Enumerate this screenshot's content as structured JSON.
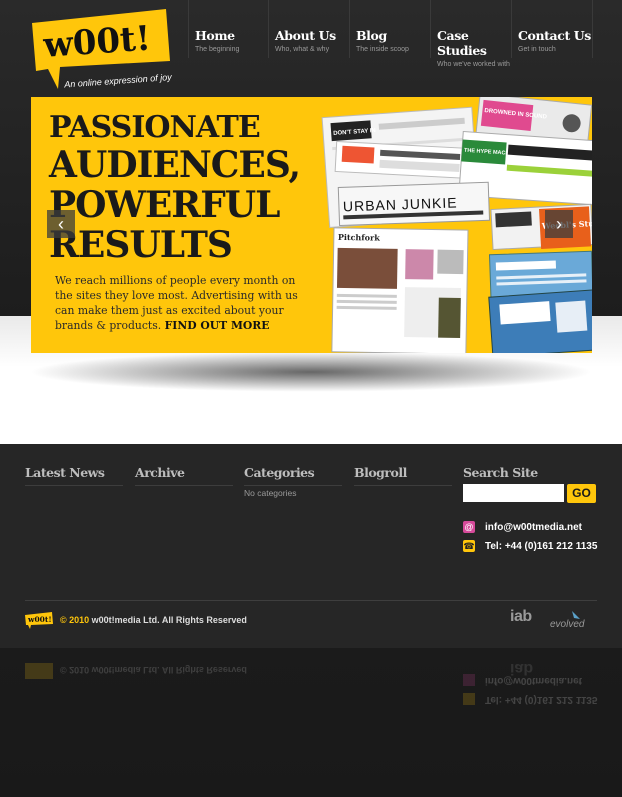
{
  "logo": {
    "wordmark": "w00t!",
    "tagline": "An online expression of joy"
  },
  "nav": [
    {
      "title": "Home",
      "sub": "The beginning"
    },
    {
      "title": "About Us",
      "sub": "Who, what & why"
    },
    {
      "title": "Blog",
      "sub": "The inside scoop"
    },
    {
      "title": "Case Studies",
      "sub": "Who we've worked with"
    },
    {
      "title": "Contact Us",
      "sub": "Get in touch"
    }
  ],
  "banner": {
    "headline": [
      "PASSIONATE",
      "AUDIENCES,",
      "POWERFUL",
      "RESULTS"
    ],
    "blurb": "We reach millions of people every month on the sites they love most. Advertising with us can make them just as excited about your brands & products.",
    "cta": "FIND OUT MORE",
    "prev_icon": "chevron-left-icon",
    "next_icon": "chevron-right-icon",
    "collage_labels": {
      "dont_stay_in": "DON'T STAY IN",
      "drowned": "DROWNED IN SOUND",
      "hype": "THE HYPE MACHINE",
      "urban": "URBAN JUNKIE",
      "pitchfork": "Pitchfork",
      "weebl": "Weebl's Stuff"
    }
  },
  "footer": {
    "latest_news": "Latest News",
    "archive": "Archive",
    "categories": "Categories",
    "no_categories": "No categories",
    "blogroll": "Blogroll",
    "search_title": "Search Site",
    "search_button": "GO",
    "email": "info@w00tmedia.net",
    "phone": "Tel: +44 (0)161 212 1135",
    "copyright_year": "© 2010",
    "copyright_rest": " w00t!media Ltd. All Rights Reserved",
    "iab": "iab",
    "evolved": "evolved"
  },
  "colors": {
    "accent": "#ffc60b",
    "dark": "#262626"
  }
}
